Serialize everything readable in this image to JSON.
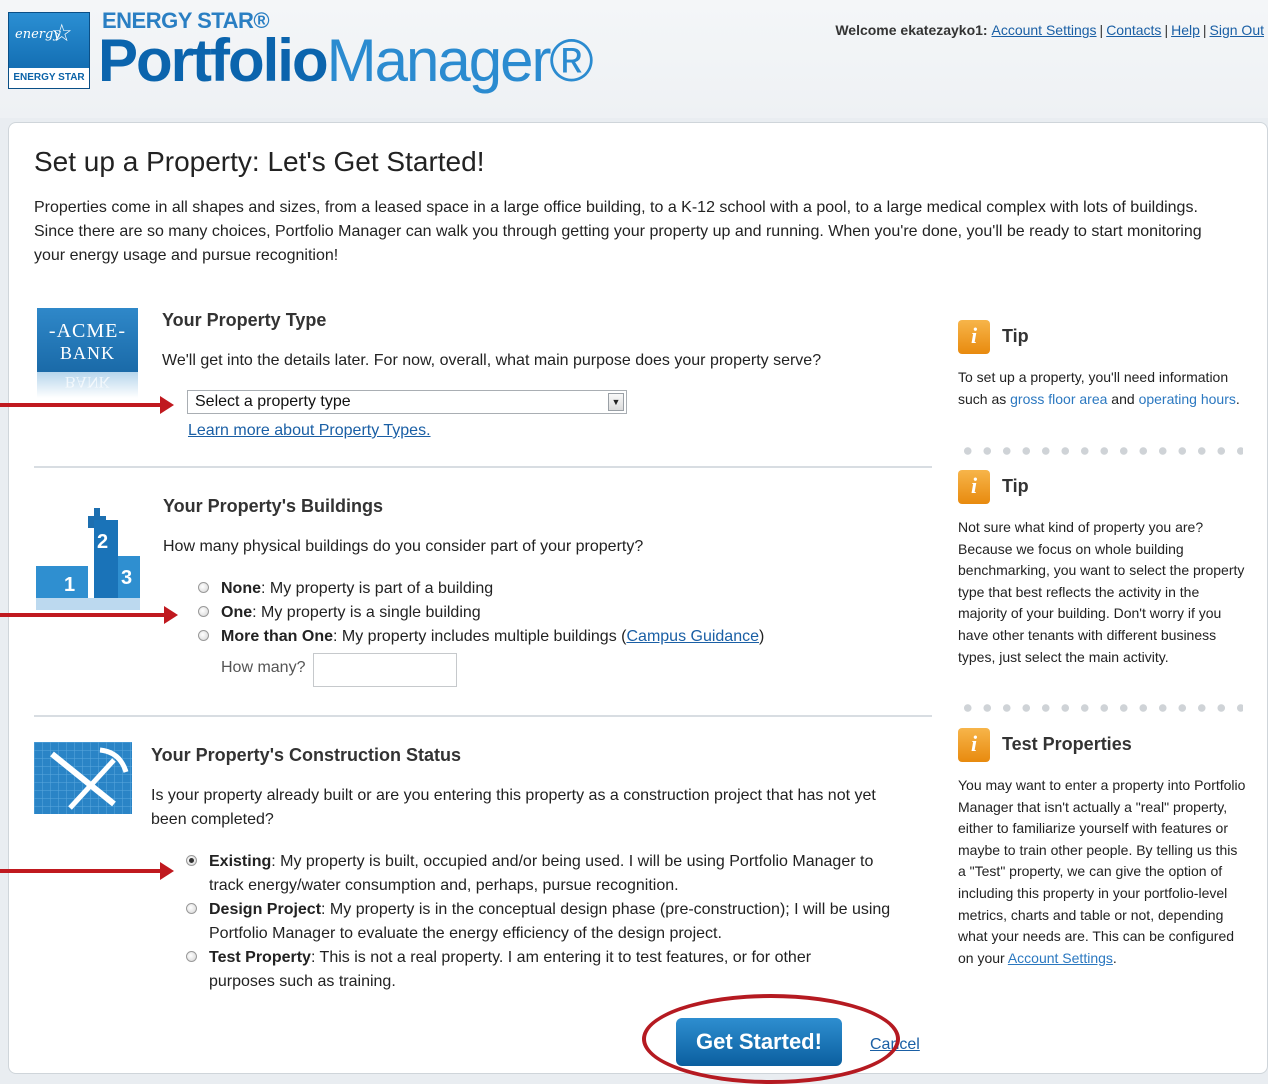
{
  "header": {
    "brand_line": "ENERGY STAR®",
    "product_part1": "Portfolio",
    "product_part2": "Manager®",
    "logo_signature": "energy",
    "logo_band": "ENERGY STAR",
    "welcome": "Welcome ekatezayko1:",
    "links": [
      "Account Settings",
      "Contacts",
      "Help",
      "Sign Out"
    ]
  },
  "page": {
    "title": "Set up a Property: Let's Get Started!",
    "intro": "Properties come in all shapes and sizes, from a leased space in a large office building, to a K-12 school with a pool, to a large medical complex with lots of buildings. Since there are so many choices, Portfolio Manager can walk you through getting your property up and running. When you're done, you'll be ready to start monitoring your energy usage and pursue recognition!"
  },
  "property_type": {
    "title": "Your Property Type",
    "question": "We'll get into the details later. For now, overall, what main purpose does your property serve?",
    "select_value": "Select a property type",
    "learn_more": "Learn more about Property Types.",
    "image_line1": "ACME",
    "image_line2": "BANK",
    "image_reflection": "BANK"
  },
  "buildings": {
    "title": "Your Property's Buildings",
    "question": "How many physical buildings do you consider part of your property?",
    "options": [
      {
        "label": "None",
        "desc": ": My property is part of a building",
        "checked": false
      },
      {
        "label": "One",
        "desc": ": My property is a single building",
        "checked": false
      },
      {
        "label": "More than One",
        "desc": ": My property includes multiple buildings (",
        "link": "Campus Guidance",
        "after": ")",
        "checked": false
      }
    ],
    "how_many_label": "How many?",
    "how_many_value": "",
    "image_numbers": [
      "1",
      "2",
      "3"
    ]
  },
  "construction": {
    "title": "Your Property's Construction Status",
    "question": "Is your property already built or are you entering this property as a construction project that has not yet been completed?",
    "options": [
      {
        "label": "Existing",
        "desc": ": My property is built, occupied and/or being used. I will be using Portfolio Manager to track energy/water consumption and, perhaps, pursue recognition.",
        "checked": true
      },
      {
        "label": "Design Project",
        "desc": ": My property is in the conceptual design phase (pre-construction); I will be using Portfolio Manager to evaluate the energy efficiency of the design project.",
        "checked": false
      },
      {
        "label": "Test Property",
        "desc": ": This is not a real property. I am entering it to test features, or for other purposes such as training.",
        "checked": false
      }
    ]
  },
  "actions": {
    "get_started": "Get Started!",
    "cancel": "Cancel"
  },
  "tips": [
    {
      "title": "Tip",
      "text_before": "To set up a property, you'll need information such as ",
      "link1": "gross floor area",
      "text_mid": " and ",
      "link2": "operating hours",
      "text_after": "."
    },
    {
      "title": "Tip",
      "text": "Not sure what kind of property you are? Because we focus on whole building benchmarking, you want to select the property type that best reflects the activity in the majority of your building. Don't worry if you have other tenants with different business types, just select the main activity."
    },
    {
      "title": "Test Properties",
      "text_before": "You may want to enter a property into Portfolio Manager that isn't actually a \"real\" property, either to familiarize yourself with features or maybe to train other people. By telling us this a \"Test\" property, we can give the option of including this property in your portfolio-level metrics, charts and table or not, depending what your needs are. This can be configured on your ",
      "link": "Account Settings",
      "text_after": "."
    }
  ],
  "colors": {
    "brand_blue": "#0b64ad",
    "link_blue": "#1a5fa5",
    "annotation_red": "#c0191f",
    "tip_orange": "#f0a02a"
  }
}
